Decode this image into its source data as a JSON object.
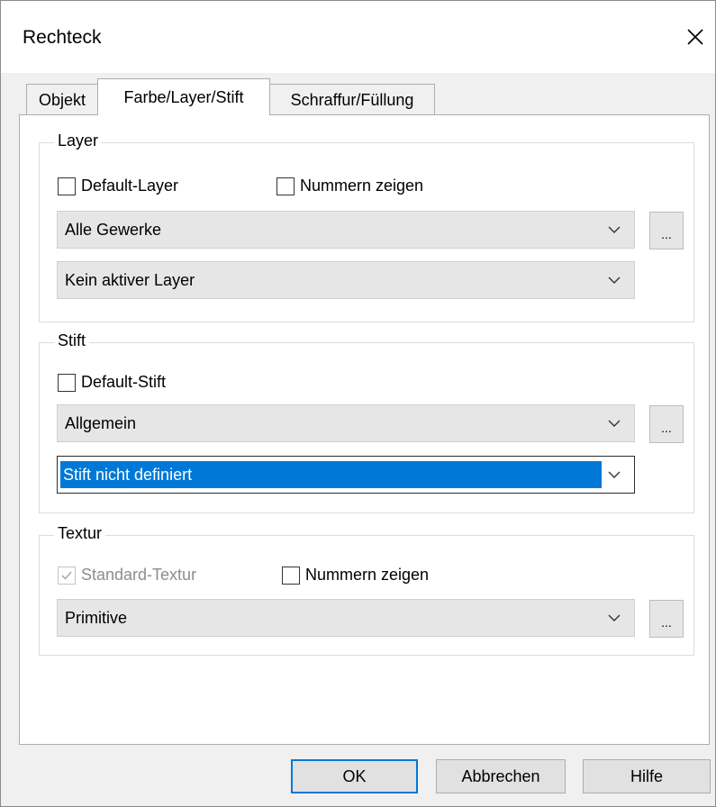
{
  "dialog": {
    "title": "Rechteck",
    "close_icon": "close-icon"
  },
  "tabs": [
    {
      "label": "Objekt",
      "active": false
    },
    {
      "label": "Farbe/Layer/Stift",
      "active": true
    },
    {
      "label": "Schraffur/Füllung",
      "active": false
    }
  ],
  "layer": {
    "group_label": "Layer",
    "default_layer_label": "Default-Layer",
    "default_layer_checked": false,
    "show_numbers_label": "Nummern zeigen",
    "show_numbers_checked": false,
    "combo1_value": "Alle Gewerke",
    "combo2_value": "Kein aktiver Layer",
    "dots_label": "..."
  },
  "pen": {
    "group_label": "Stift",
    "default_pen_label": "Default-Stift",
    "default_pen_checked": false,
    "combo1_value": "Allgemein",
    "combo2_value": "Stift nicht definiert",
    "dots_label": "..."
  },
  "texture": {
    "group_label": "Textur",
    "standard_texture_label": "Standard-Textur",
    "standard_texture_checked": true,
    "standard_texture_disabled": true,
    "show_numbers_label": "Nummern zeigen",
    "show_numbers_checked": false,
    "combo_value": "Primitive",
    "dots_label": "..."
  },
  "buttons": {
    "ok": "OK",
    "cancel": "Abbrechen",
    "help": "Hilfe"
  },
  "colors": {
    "accent": "#0078d7",
    "dialog_bg": "#f0f0f0",
    "combo_bg": "#e6e6e6"
  }
}
